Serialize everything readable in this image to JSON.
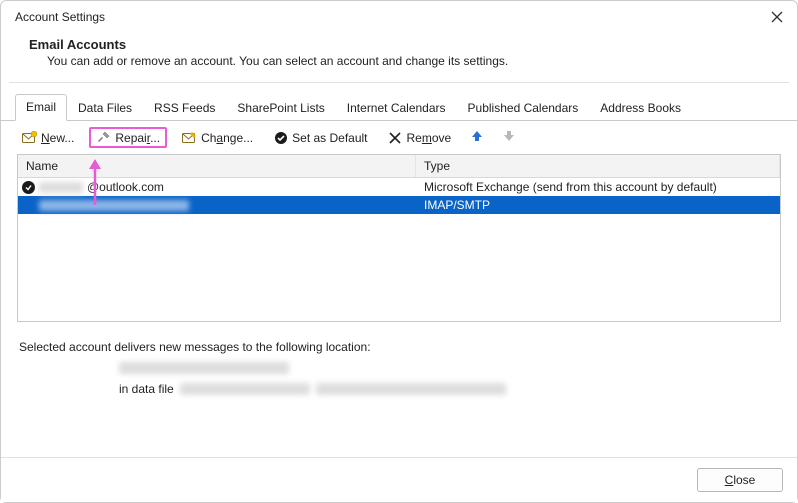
{
  "window": {
    "title": "Account Settings"
  },
  "header": {
    "title": "Email Accounts",
    "subtitle": "You can add or remove an account. You can select an account and change its settings."
  },
  "tabs": [
    {
      "label": "Email",
      "active": true
    },
    {
      "label": "Data Files"
    },
    {
      "label": "RSS Feeds"
    },
    {
      "label": "SharePoint Lists"
    },
    {
      "label": "Internet Calendars"
    },
    {
      "label": "Published Calendars"
    },
    {
      "label": "Address Books"
    }
  ],
  "toolbar": {
    "new": "New...",
    "repair": "Repair...",
    "change": "Change...",
    "set_default": "Set as Default",
    "remove": "Remove"
  },
  "columns": {
    "name": "Name",
    "type": "Type"
  },
  "accounts": [
    {
      "default": true,
      "name_redacted": true,
      "name_suffix": "@outlook.com",
      "type": "Microsoft Exchange (send from this account by default)",
      "selected": false
    },
    {
      "default": false,
      "name_redacted": true,
      "name_suffix": "",
      "type": "IMAP/SMTP",
      "selected": true
    }
  ],
  "delivery": {
    "intro": "Selected account delivers new messages to the following location:",
    "in_data_file": "in data file"
  },
  "footer": {
    "close": "Close"
  },
  "highlight": {
    "color": "#e85ad6"
  }
}
